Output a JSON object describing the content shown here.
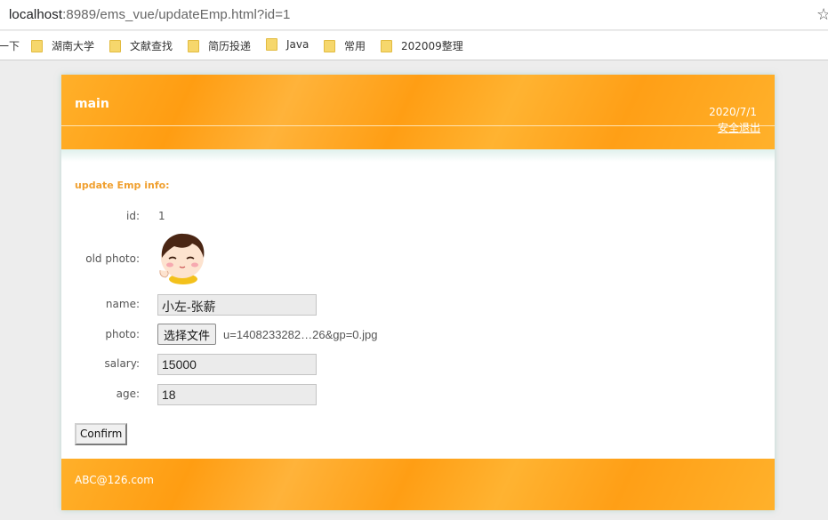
{
  "browser": {
    "url_host": "localhost",
    "url_rest": ":8989/ems_vue/updateEmp.html?id=1",
    "bookmarks_first": "一下",
    "bookmarks": [
      "湖南大学",
      "文献查找",
      "简历投递",
      "Java",
      "常用",
      "202009整理"
    ]
  },
  "header": {
    "title": "main",
    "date": "2020/7/1",
    "logout": "安全退出"
  },
  "form": {
    "title": "update Emp info:",
    "id_label": "id:",
    "id_value": "1",
    "old_photo_label": "old photo:",
    "name_label": "name:",
    "name_value": "小左-张薪",
    "photo_label": "photo:",
    "file_button": "选择文件",
    "file_name": "u=1408233282…26&gp=0.jpg",
    "salary_label": "salary:",
    "salary_value": "15000",
    "age_label": "age:",
    "age_value": "18",
    "confirm": "Confirm"
  },
  "footer": {
    "email": "ABC@126.com"
  },
  "colors": {
    "accent_orange": "#ff9f16",
    "form_title": "#f0a030"
  }
}
